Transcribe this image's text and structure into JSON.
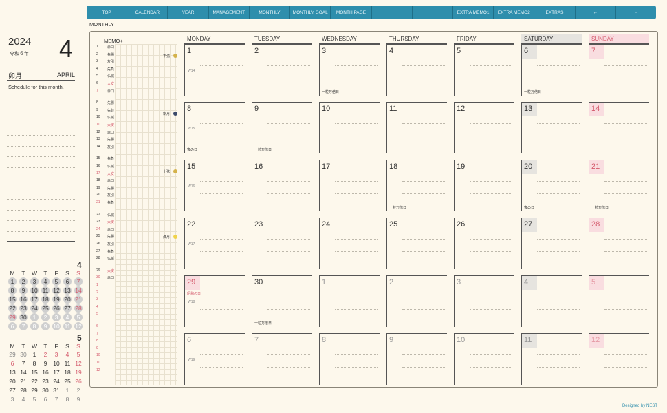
{
  "nav": {
    "items": [
      "TOP",
      "CALENDAR",
      "YEAR",
      "MANAGEMENT",
      "MONTHLY",
      "MONTHLY GOAL",
      "MONTH PAGE",
      "",
      "",
      "EXTRA MEMO1",
      "EXTRA MEMO2",
      "EXTRAS",
      "←",
      "→"
    ]
  },
  "page": {
    "section": "MONTHLY",
    "credit": "Designed by NEST"
  },
  "sidebar": {
    "year": "2024",
    "era": "令和６年",
    "month_number": "4",
    "month_jp": "卯月",
    "month_en": "APRIL",
    "schedule_label": "Schedule for this month."
  },
  "mini_calendars": [
    {
      "label": "4",
      "headers": [
        "M",
        "T",
        "W",
        "T",
        "F",
        "S",
        "S"
      ],
      "weeks": [
        [
          "1",
          "2",
          "3",
          "4",
          "5",
          "6",
          "7"
        ],
        [
          "8",
          "9",
          "10",
          "11",
          "12",
          "13",
          "14"
        ],
        [
          "15",
          "16",
          "17",
          "18",
          "19",
          "20",
          "21"
        ],
        [
          "22",
          "23",
          "24",
          "25",
          "26",
          "27",
          "28"
        ],
        [
          "29",
          "30",
          "1",
          "2",
          "3",
          "4",
          "5"
        ],
        [
          "6",
          "7",
          "8",
          "9",
          "10",
          "11",
          "12"
        ]
      ]
    },
    {
      "label": "5",
      "headers": [
        "M",
        "T",
        "W",
        "T",
        "F",
        "S",
        "S"
      ],
      "weeks": [
        [
          "29",
          "30",
          "1",
          "2",
          "3",
          "4",
          "5"
        ],
        [
          "6",
          "7",
          "8",
          "9",
          "10",
          "11",
          "12"
        ],
        [
          "13",
          "14",
          "15",
          "16",
          "17",
          "18",
          "19"
        ],
        [
          "20",
          "21",
          "22",
          "23",
          "24",
          "25",
          "26"
        ],
        [
          "27",
          "28",
          "29",
          "30",
          "31",
          "1",
          "2"
        ],
        [
          "3",
          "4",
          "5",
          "6",
          "7",
          "8",
          "9"
        ]
      ]
    }
  ],
  "memo": {
    "title": "MEMO+",
    "rows": [
      [
        "1",
        "赤口"
      ],
      [
        "2",
        "先勝"
      ],
      [
        "3",
        "友引"
      ],
      [
        "4",
        "先負"
      ],
      [
        "5",
        "仏滅"
      ],
      [
        "6",
        "大安"
      ],
      [
        "7",
        "赤口"
      ],
      [
        "8",
        "先勝"
      ],
      [
        "9",
        "先負"
      ],
      [
        "10",
        "仏滅"
      ],
      [
        "11",
        "大安"
      ],
      [
        "12",
        "赤口"
      ],
      [
        "13",
        "先勝"
      ],
      [
        "14",
        "友引"
      ],
      [
        "15",
        "先負"
      ],
      [
        "16",
        "仏滅"
      ],
      [
        "17",
        "大安"
      ],
      [
        "18",
        "赤口"
      ],
      [
        "19",
        "先勝"
      ],
      [
        "20",
        "友引"
      ],
      [
        "21",
        "先負"
      ],
      [
        "22",
        "仏滅"
      ],
      [
        "23",
        "大安"
      ],
      [
        "24",
        "赤口"
      ],
      [
        "25",
        "先勝"
      ],
      [
        "26",
        "友引"
      ],
      [
        "27",
        "先負"
      ],
      [
        "28",
        "仏滅"
      ],
      [
        "29",
        "大安"
      ],
      [
        "30",
        "赤口"
      ],
      [
        "1",
        ""
      ],
      [
        "2",
        ""
      ],
      [
        "3",
        ""
      ],
      [
        "4",
        ""
      ],
      [
        "5",
        ""
      ],
      [
        "6",
        ""
      ],
      [
        "7",
        ""
      ],
      [
        "8",
        ""
      ],
      [
        "9",
        ""
      ],
      [
        "10",
        ""
      ],
      [
        "11",
        ""
      ],
      [
        "12",
        ""
      ]
    ],
    "moons": [
      "下弦",
      "新月",
      "上弦",
      "満月"
    ]
  },
  "calendar": {
    "headers": [
      "MONDAY",
      "TUESDAY",
      "WEDNESDAY",
      "THURSDAY",
      "FRIDAY",
      "SATURDAY",
      "SUNDAY"
    ],
    "weeks": [
      {
        "wk": "W14",
        "days": [
          "1",
          "2",
          "3",
          "4",
          "5",
          "6",
          "7"
        ],
        "notes": [
          "",
          "",
          "一粒万倍日",
          "",
          "",
          "一粒万倍日",
          ""
        ]
      },
      {
        "wk": "W15",
        "days": [
          "8",
          "9",
          "10",
          "11",
          "12",
          "13",
          "14"
        ],
        "notes": [
          "寅の日",
          "一粒万倍日",
          "",
          "",
          "",
          "",
          ""
        ]
      },
      {
        "wk": "W16",
        "days": [
          "15",
          "16",
          "17",
          "18",
          "19",
          "20",
          "21"
        ],
        "notes": [
          "",
          "",
          "",
          "一粒万倍日",
          "",
          "寅の日",
          "一粒万倍日"
        ]
      },
      {
        "wk": "W17",
        "days": [
          "22",
          "23",
          "24",
          "25",
          "26",
          "27",
          "28"
        ],
        "notes": [
          "",
          "",
          "",
          "",
          "",
          "",
          ""
        ]
      },
      {
        "wk": "W18",
        "days": [
          "29",
          "30",
          "1",
          "2",
          "3",
          "4",
          "5"
        ],
        "notes": [
          "昭和の日",
          "一粒万倍日",
          "",
          "",
          "",
          "",
          ""
        ]
      },
      {
        "wk": "W19",
        "days": [
          "6",
          "7",
          "8",
          "9",
          "10",
          "11",
          "12"
        ],
        "notes": [
          "",
          "",
          "",
          "",
          "",
          "",
          ""
        ]
      }
    ]
  }
}
